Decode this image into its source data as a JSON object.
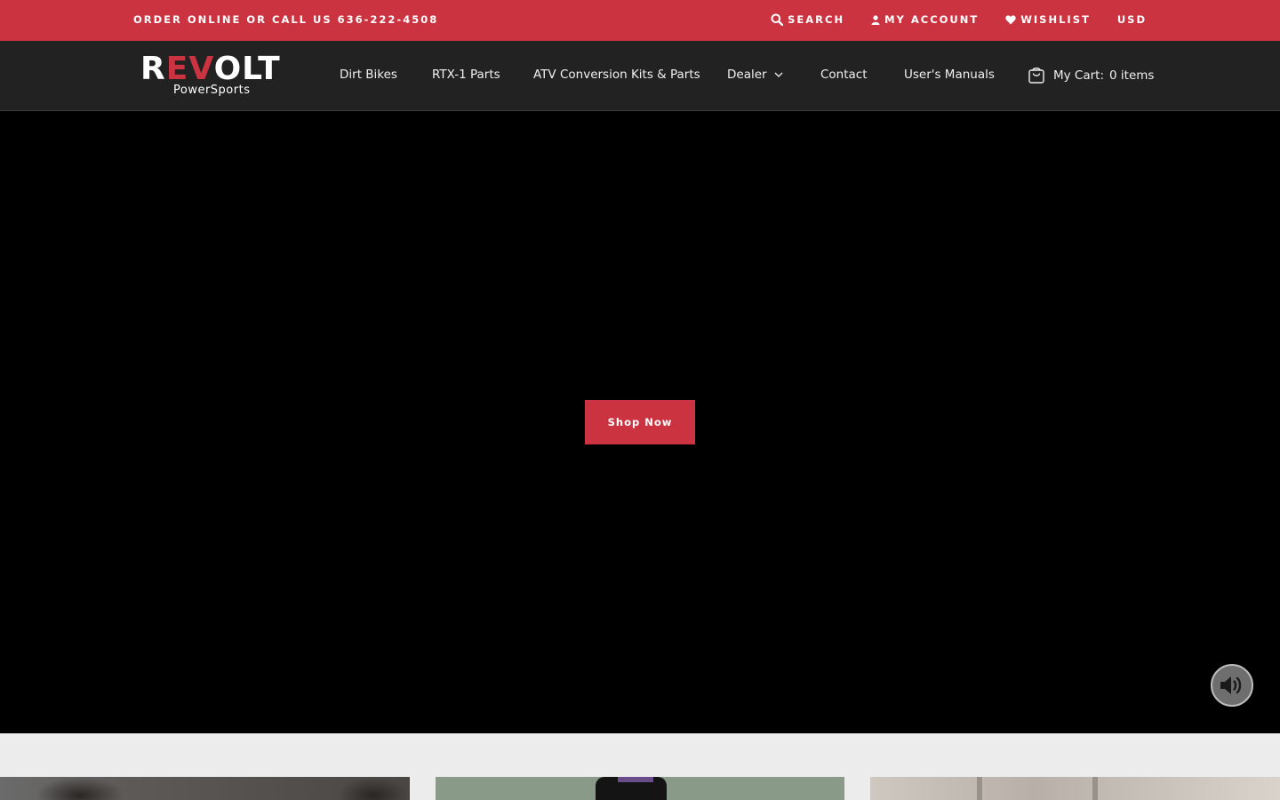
{
  "topbar": {
    "promo": "ORDER ONLINE OR CALL US 636-222-4508",
    "search_label": "SEARCH",
    "account_label": "MY ACCOUNT",
    "wishlist_label": "WISHLIST",
    "currency": "USD"
  },
  "brand": {
    "logo_main_a": "R",
    "logo_main_b": "EV",
    "logo_main_c": "OLT",
    "logo_sub": "PowerSports"
  },
  "nav": {
    "items": [
      {
        "label": "Dirt Bikes"
      },
      {
        "label": "RTX-1 Parts"
      },
      {
        "label": "ATV Conversion Kits & Parts"
      },
      {
        "label": "Dealer"
      },
      {
        "label": "Contact"
      },
      {
        "label": "User's Manuals"
      }
    ],
    "cart_label": "My Cart:",
    "cart_count": "0 items"
  },
  "hero": {
    "button_label": "Shop Now"
  },
  "colors": {
    "accent": "#cc3340",
    "header_bg": "#222222",
    "hero_bg": "#000000"
  },
  "icons": {
    "search": "search-icon",
    "account": "user-icon",
    "wishlist": "heart-icon",
    "dropdown": "chevron-down-icon",
    "cart": "shopping-bag-icon",
    "mute": "speaker-icon"
  }
}
